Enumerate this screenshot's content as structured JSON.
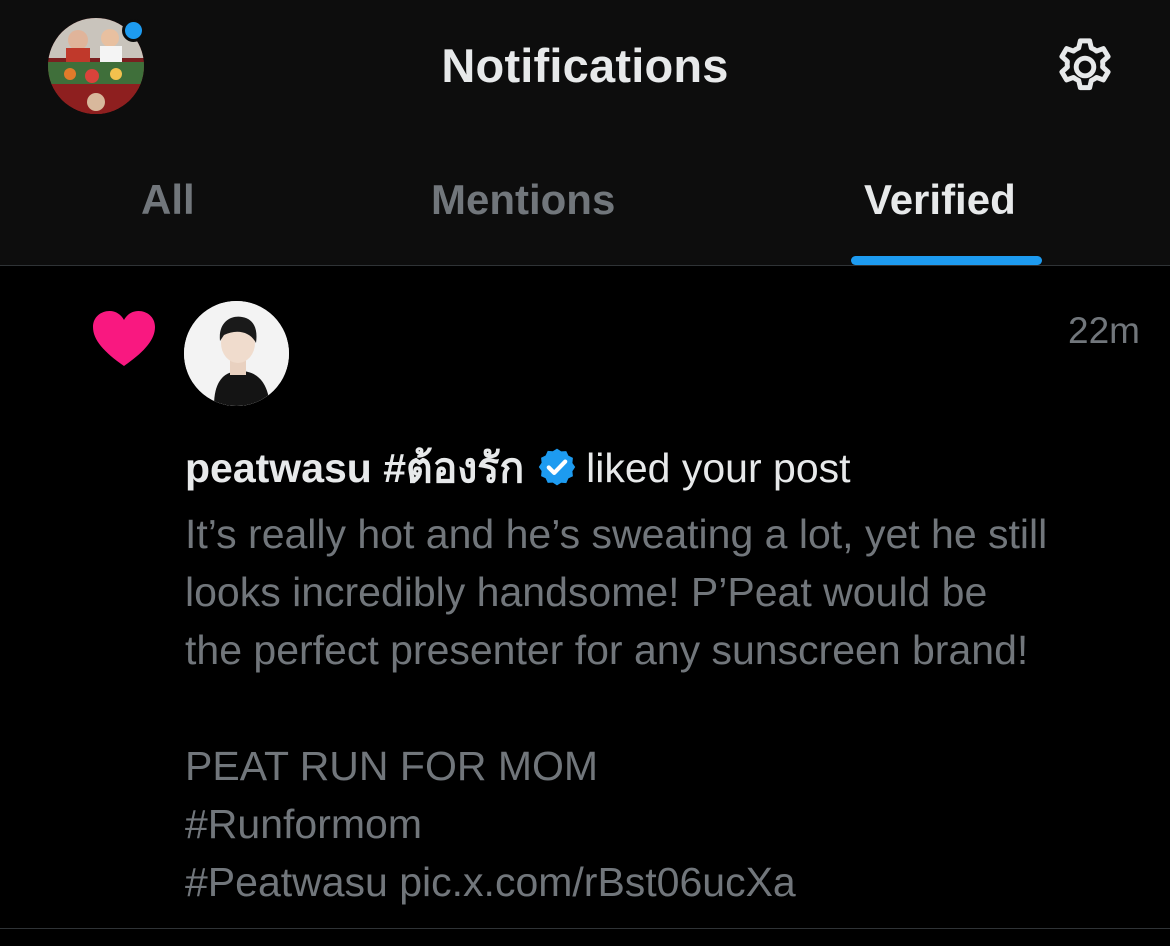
{
  "header": {
    "title": "Notifications",
    "profile_icon": "account-avatar",
    "settings_icon": "gear-icon",
    "has_unread_dot": true
  },
  "tabs": [
    {
      "label": "All",
      "active": false
    },
    {
      "label": "Mentions",
      "active": false
    },
    {
      "label": "Verified",
      "active": true
    }
  ],
  "notification": {
    "icon": "heart-icon",
    "icon_color": "#f91880",
    "username": "peatwasu #ต้องรัก",
    "verified": true,
    "action": "liked your post",
    "time": "22m",
    "post_lines": [
      "It’s really hot and he’s sweating a lot, yet he still",
      "looks incredibly handsome! P’Peat would be",
      "the perfect presenter for any sunscreen brand!",
      "",
      "PEAT RUN FOR MOM",
      "#Runformom",
      "#Peatwasu pic.x.com/rBst06ucXa"
    ]
  },
  "colors": {
    "background": "#000000",
    "header_background": "#0d0d0d",
    "accent": "#1d9bf0",
    "text_primary": "#e7e9ea",
    "text_secondary": "#71767b",
    "like": "#f91880"
  }
}
